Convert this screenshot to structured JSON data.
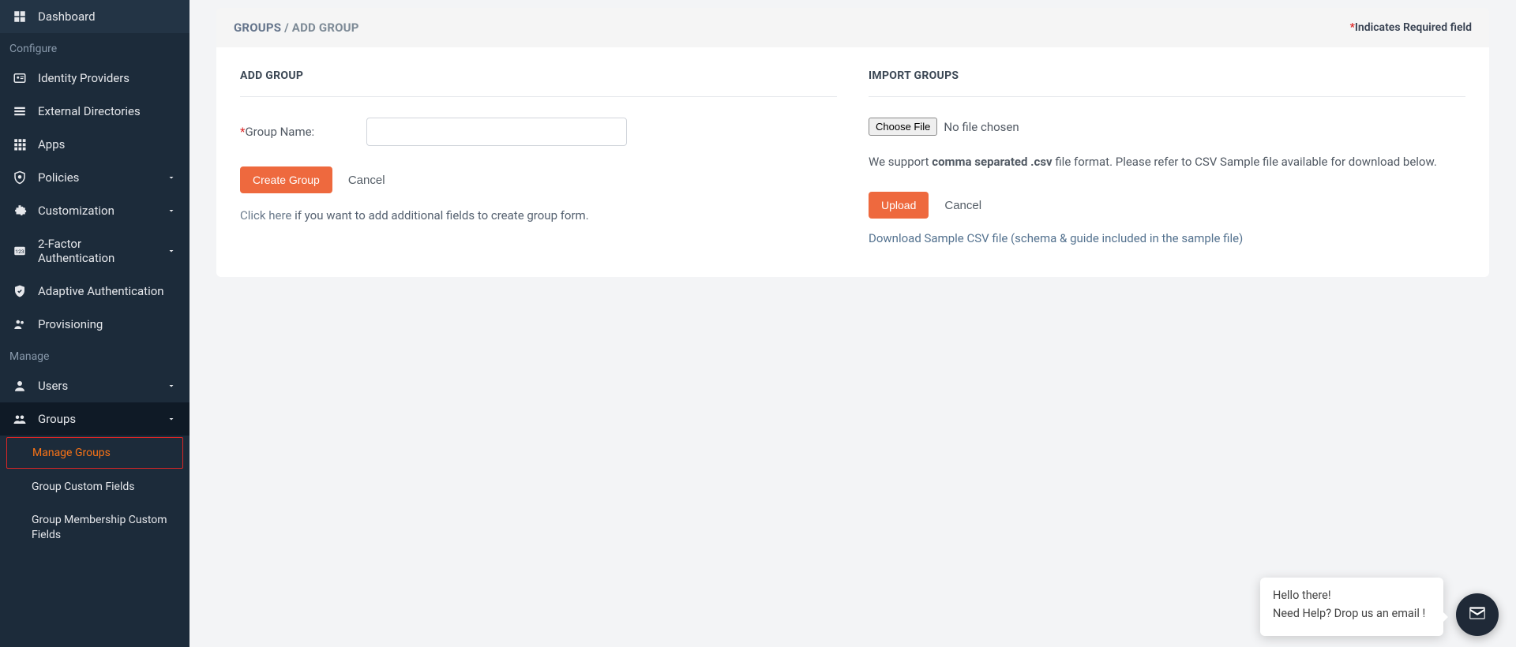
{
  "sidebar": {
    "dashboard": "Dashboard",
    "section_configure": "Configure",
    "identity_providers": "Identity Providers",
    "external_directories": "External Directories",
    "apps": "Apps",
    "policies": "Policies",
    "customization": "Customization",
    "two_factor": "2-Factor Authentication",
    "adaptive_auth": "Adaptive Authentication",
    "provisioning": "Provisioning",
    "section_manage": "Manage",
    "users": "Users",
    "groups": "Groups",
    "groups_sub": {
      "manage": "Manage Groups",
      "custom_fields": "Group Custom Fields",
      "membership_custom_fields": "Group Membership Custom Fields"
    }
  },
  "breadcrumb": {
    "groups": "GROUPS",
    "sep": " / ",
    "current": "ADD GROUP"
  },
  "header": {
    "required_star": "*",
    "required_text": "Indicates Required field"
  },
  "add_group": {
    "title": "ADD GROUP",
    "label_star": "*",
    "label": "Group Name:",
    "value": "",
    "btn_create": "Create Group",
    "btn_cancel": "Cancel",
    "click_here": "Click here",
    "click_here_after": " if you want to add additional fields to create group form."
  },
  "import": {
    "title": "IMPORT GROUPS",
    "choose_file": "Choose File",
    "no_file": "No file chosen",
    "help_pre": "We support ",
    "help_bold": "comma separated .csv",
    "help_post": " file format. Please refer to CSV Sample file available for download below.",
    "btn_upload": "Upload",
    "btn_cancel": "Cancel",
    "download_link": "Download Sample CSV file (schema & guide included in the sample file)"
  },
  "chat": {
    "line1": "Hello there!",
    "line2": "Need Help? Drop us an email !"
  }
}
